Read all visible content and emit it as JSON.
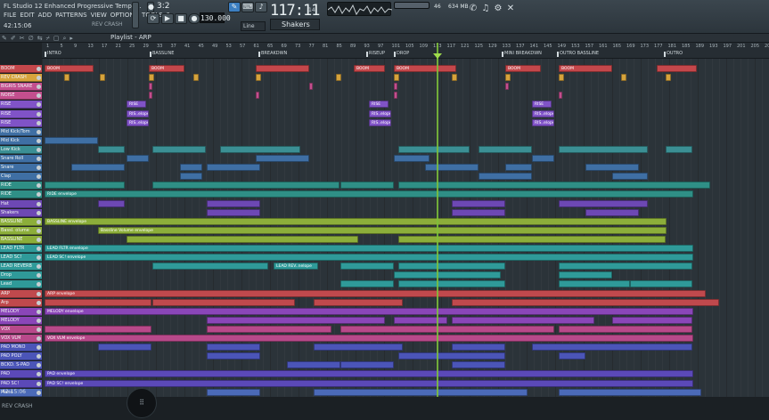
{
  "window": {
    "title": "FL Studio 12 Enhanced Progressive Templa..",
    "time": "42:15:06",
    "hint": "REV CRASH"
  },
  "menu": [
    "FILE",
    "EDIT",
    "ADD",
    "PATTERNS",
    "VIEW",
    "OPTIONS",
    "TOOLS",
    "?"
  ],
  "transport": {
    "mode": "3:2",
    "tempo": "130.000",
    "song_position": "117:11",
    "song_position_sub": "14",
    "pattern": "Shakers",
    "snap": "Line",
    "cpu": "46",
    "memory": "634 MB"
  },
  "playlist": {
    "title": "Playlist - ARP"
  },
  "ruler": {
    "bars": [
      "1",
      "5",
      "9",
      "13",
      "17",
      "21",
      "25",
      "29",
      "33",
      "37",
      "41",
      "45",
      "49",
      "53",
      "57",
      "61",
      "65",
      "69",
      "73",
      "77",
      "81",
      "85",
      "89",
      "93",
      "97",
      "101",
      "105",
      "109",
      "113",
      "117",
      "121",
      "125",
      "129",
      "133",
      "137",
      "141",
      "145",
      "149",
      "153",
      "157",
      "161",
      "165",
      "169",
      "173",
      "177",
      "181",
      "185",
      "189",
      "193",
      "197",
      "201",
      "205",
      "209"
    ],
    "markers": [
      {
        "label": "INTRO"
      },
      {
        "label": "BASSLINE"
      },
      {
        "label": "BREAKDWN"
      },
      {
        "label": "RISEUP"
      },
      {
        "label": "DROP"
      },
      {
        "label": "MINI BREAKDWN"
      },
      {
        "label": "OUTRO BASSLINE"
      },
      {
        "label": "OUTRO"
      }
    ]
  },
  "tracks": [
    {
      "name": "BOOM",
      "color": "#c4474b"
    },
    {
      "name": "REV CRASH",
      "color": "#d6a33c"
    },
    {
      "name": "BIGRIS SNARE",
      "color": "#c34f8e"
    },
    {
      "name": "NOISE",
      "color": "#c34f8e"
    },
    {
      "name": "RISE",
      "color": "#8053c7"
    },
    {
      "name": "RISE",
      "color": "#8053c7"
    },
    {
      "name": "RISE",
      "color": "#8053c7"
    },
    {
      "name": "Mid Kick/Tom",
      "color": "#3f6fa4"
    },
    {
      "name": "Mid Kick",
      "color": "#3f6fa4"
    },
    {
      "name": "Low Kick",
      "color": "#3b8f94"
    },
    {
      "name": "Snare Roll",
      "color": "#3f6fa4"
    },
    {
      "name": "Snare",
      "color": "#3f6fa4"
    },
    {
      "name": "Clap",
      "color": "#3f6fa4"
    },
    {
      "name": "RIDE",
      "color": "#2f8f86"
    },
    {
      "name": "RIDE",
      "color": "#2f8f86"
    },
    {
      "name": "Hat",
      "color": "#6d48b4"
    },
    {
      "name": "Shakers",
      "color": "#6d48b4"
    },
    {
      "name": "BASSLINE",
      "color": "#8cae3a"
    },
    {
      "name": "Bassl. olume",
      "color": "#8cae3a"
    },
    {
      "name": "BASSLINE",
      "color": "#8cae3a"
    },
    {
      "name": "LEAD FLTR",
      "color": "#2f9a99"
    },
    {
      "name": "LEAD SC!",
      "color": "#2f9a99"
    },
    {
      "name": "LEAD REVERB",
      "color": "#2f9a99"
    },
    {
      "name": "Drop",
      "color": "#2f9a99"
    },
    {
      "name": "Lead",
      "color": "#2f9a99"
    },
    {
      "name": "ARP",
      "color": "#c0494d"
    },
    {
      "name": "Arp",
      "color": "#c0494d"
    },
    {
      "name": "MELODY",
      "color": "#8a46b8"
    },
    {
      "name": "MELODY",
      "color": "#8a46b8"
    },
    {
      "name": "VOX",
      "color": "#b8498a"
    },
    {
      "name": "VOX VLM",
      "color": "#b8498a"
    },
    {
      "name": "PAD MONO",
      "color": "#4b55b8"
    },
    {
      "name": "PAD POLY",
      "color": "#4b55b8"
    },
    {
      "name": "BCKD. S-PAD",
      "color": "#4b55b8"
    },
    {
      "name": "PAD",
      "color": "#5b49b8"
    },
    {
      "name": "PAD SC!",
      "color": "#5b49b8"
    },
    {
      "name": "Piano",
      "color": "#4b6ab8"
    }
  ],
  "clip_labels": {
    "boom": "BOOM",
    "rise": "RISE",
    "rise_env": "RIS..elope",
    "ride_env": "RIDE envelope",
    "bassline_env": "BASSLINE envelope",
    "bass_vol_env": "Bassline Volume envelope",
    "lead_fltr_env": "LEAD FLTR envelope",
    "lead_sc_env": "LEAD SC! envelope",
    "lead_rev_env": "LEAD REV..nelope",
    "arp_env": "ARP envelope",
    "melody_env": "MELODY envelope",
    "vox_env": "VOX VLM envelope",
    "pad_env": "PAD envelope",
    "pad_sc_env": "PAD SC! envelope"
  },
  "colors": {
    "accent": "#7ec23a",
    "playhead": "#7ec23a"
  },
  "bottom": {
    "time": "42:15:06",
    "hint": "REV CRASH"
  }
}
